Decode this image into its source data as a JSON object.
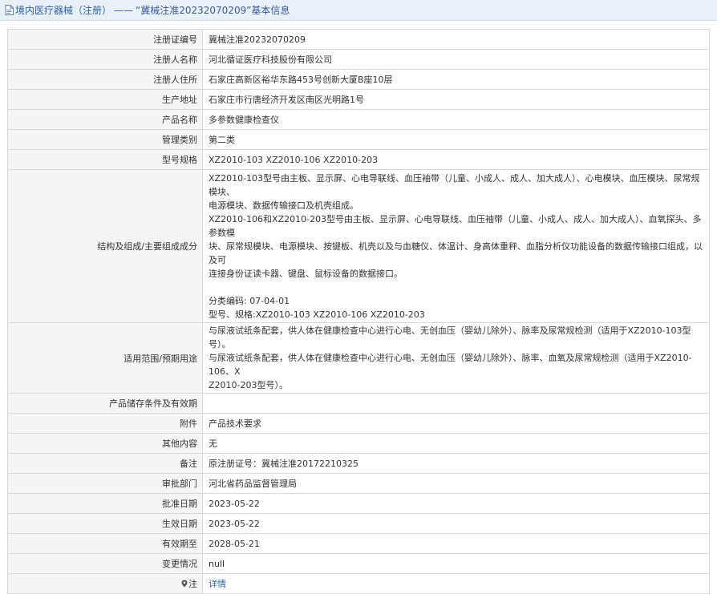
{
  "header": {
    "section_label": "境内医疗器械（注册）",
    "separator": "——",
    "record_title": "“冀械注准20232070209”基本信息"
  },
  "fields": {
    "reg_no": {
      "label": "注册证编号",
      "value": "冀械注准20232070209"
    },
    "registrant": {
      "label": "注册人名称",
      "value": "河北循证医疗科技股份有限公司"
    },
    "registrant_address": {
      "label": "注册人住所",
      "value": "石家庄高新区裕华东路453号创新大厦B座10层"
    },
    "production_address": {
      "label": "生产地址",
      "value": "石家庄市行唐经济开发区南区光明路1号"
    },
    "product_name": {
      "label": "产品名称",
      "value": "多参数健康检查仪"
    },
    "mgmt_category": {
      "label": "管理类别",
      "value": "第二类"
    },
    "model_spec": {
      "label": "型号规格",
      "value": "XZ2010-103 XZ2010-106 XZ2010-203"
    },
    "structure": {
      "label": "结构及组成/主要组成成分",
      "lines": [
        "XZ2010-103型号由主板、显示屏、心电导联线、血压袖带（儿童、小成人、成人、加大成人）、心电模块、血压模块、尿常规模块、",
        "电源模块、数据传输接口及机壳组成。",
        "XZ2010-106和XZ2010-203型号由主板、显示屏、心电导联线、血压袖带（儿童、小成人、成人、加大成人）、血氧探头、多参数模",
        "块、尿常规模块、电源模块、按键板、机壳以及与血糖仪、体温计、身高体重秤、血脂分析仪功能设备的数据传输接口组成，以及可",
        "连接身份证读卡器、键盘、鼠标设备的数据接口。",
        "分类编码: 07-04-01",
        "型号、规格:XZ2010-103 XZ2010-106 XZ2010-203"
      ]
    },
    "intended_use": {
      "label": "适用范围/预期用途",
      "lines": [
        "与尿液试纸条配套，供人体在健康检查中心进行心电、无创血压（婴幼儿除外）、脉率及尿常规检测（适用于XZ2010-103型号）。",
        "与尿液试纸条配套，供人体在健康检查中心进行心电、无创血压（婴幼儿除外）、脉率、血氧及尿常规检测（适用于XZ2010-106、X",
        "Z2010-203型号）。"
      ]
    },
    "storage": {
      "label": "产品储存条件及有效期",
      "value": ""
    },
    "attachment": {
      "label": "附件",
      "value": "产品技术要求"
    },
    "other": {
      "label": "其他内容",
      "value": "无"
    },
    "remark": {
      "label": "备注",
      "value": "原注册证号：冀械注准20172210325"
    },
    "approval_dept": {
      "label": "审批部门",
      "value": "河北省药品监督管理局"
    },
    "approval_date": {
      "label": "批准日期",
      "value": "2023-05-22"
    },
    "effective_date": {
      "label": "生效日期",
      "value": "2023-05-22"
    },
    "valid_until": {
      "label": "有效期至",
      "value": "2028-05-21"
    },
    "change": {
      "label": "变更情况",
      "value": "null"
    },
    "note": {
      "label": "注",
      "value": "详情"
    }
  },
  "icons": {
    "header": "document-icon",
    "note": "pin-icon"
  },
  "colors": {
    "header_bg": "#eaf0f7",
    "link": "#2d63a6",
    "label_bg": "#f5f5f5",
    "border": "#d9d9d9"
  }
}
